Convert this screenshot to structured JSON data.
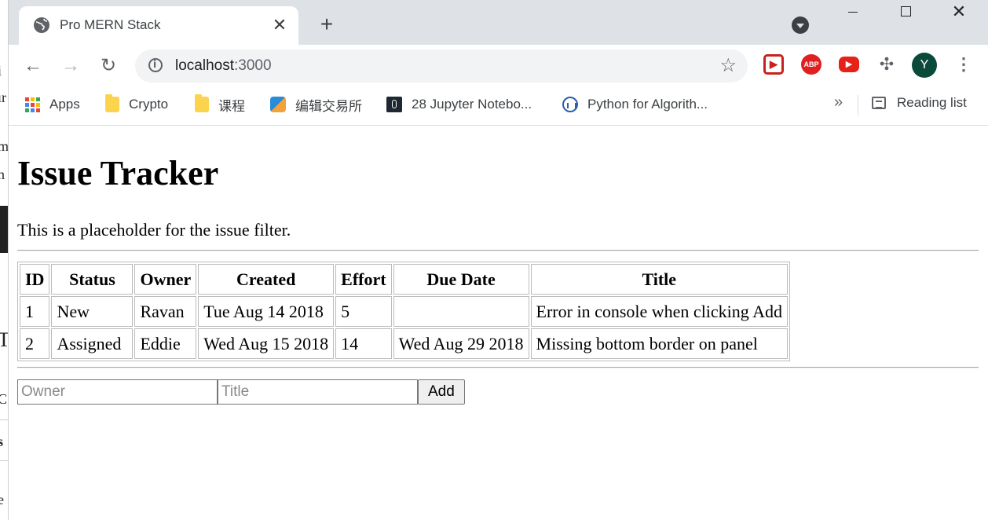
{
  "background_window": {
    "fragments": [
      "i",
      "ır",
      "m",
      "n",
      "T",
      "C",
      "s",
      "e"
    ]
  },
  "tab": {
    "title": "Pro MERN Stack",
    "close": "✕"
  },
  "new_tab": "+",
  "window_controls": {
    "close": "✕"
  },
  "toolbar": {
    "back": "←",
    "forward": "→",
    "reload": "↻",
    "url_host": "localhost",
    "url_port": ":3000",
    "star": "☆",
    "extensions": [
      "▶",
      "ABP",
      "▶",
      "✣"
    ],
    "avatar_letter": "Y",
    "menu": "⋮"
  },
  "bookmarks": {
    "items": [
      {
        "label": "Apps",
        "icon": "apps-grid-icon"
      },
      {
        "label": "Crypto",
        "icon": "folder-icon"
      },
      {
        "label": "课程",
        "icon": "folder-icon"
      },
      {
        "label": "编辑交易所",
        "icon": "exchange-icon"
      },
      {
        "label": "28 Jupyter Notebo...",
        "icon": "jupyter-icon"
      },
      {
        "label": "Python for Algorith...",
        "icon": "python-icon"
      }
    ],
    "overflow": "»",
    "reading_list": "Reading list"
  },
  "page": {
    "heading": "Issue Tracker",
    "filter_placeholder": "This is a placeholder for the issue filter.",
    "table": {
      "headers": [
        "ID",
        "Status",
        "Owner",
        "Created",
        "Effort",
        "Due Date",
        "Title"
      ],
      "rows": [
        [
          "1",
          "New",
          "Ravan",
          "Tue Aug 14 2018",
          "5",
          "",
          "Error in console when clicking Add"
        ],
        [
          "2",
          "Assigned",
          "Eddie",
          "Wed Aug 15 2018",
          "14",
          "Wed Aug 29 2018",
          "Missing bottom border on panel"
        ]
      ]
    },
    "form": {
      "owner_placeholder": "Owner",
      "title_placeholder": "Title",
      "add_label": "Add"
    }
  },
  "colors": {
    "tabstrip": "#dee1e6",
    "omnibox": "#f1f3f4",
    "avatar": "#0b4a3b",
    "ext_red": "#e02020"
  }
}
